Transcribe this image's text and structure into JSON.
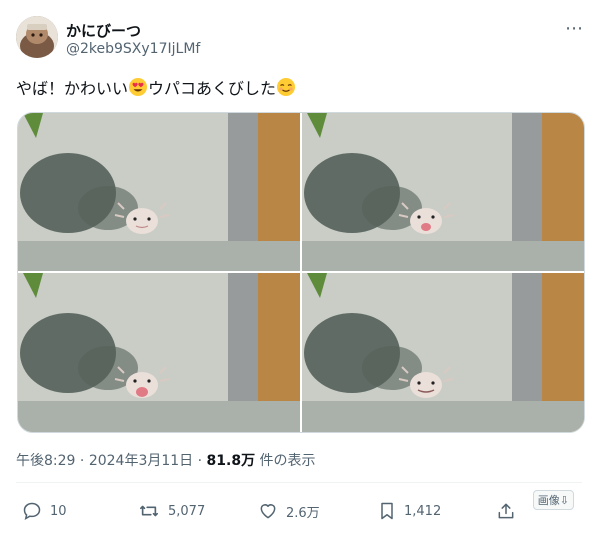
{
  "user": {
    "display_name": "かにびーつ",
    "handle": "@2keb9SXy17IjLMf"
  },
  "more_icon": "more-horizontal-icon",
  "tweet": {
    "text_part1": "やば！かわいい",
    "text_part2": "ウパコあくびした",
    "emojis": [
      "heart-eyes-emoji",
      "relieved-face-emoji"
    ]
  },
  "meta": {
    "time": "午後8:29",
    "sep1": " · ",
    "date": "2024年3月11日",
    "sep2": " · ",
    "views": "81.8万",
    "views_label": " 件の表示"
  },
  "actions": {
    "reply_count": "10",
    "retweet_count": "5,077",
    "like_count": "2.6万",
    "bookmark_count": "1,412"
  },
  "translate_label": "画像⇩",
  "colors": {
    "text": "#0f1419",
    "secondary": "#536471",
    "border": "#cfd9de"
  }
}
